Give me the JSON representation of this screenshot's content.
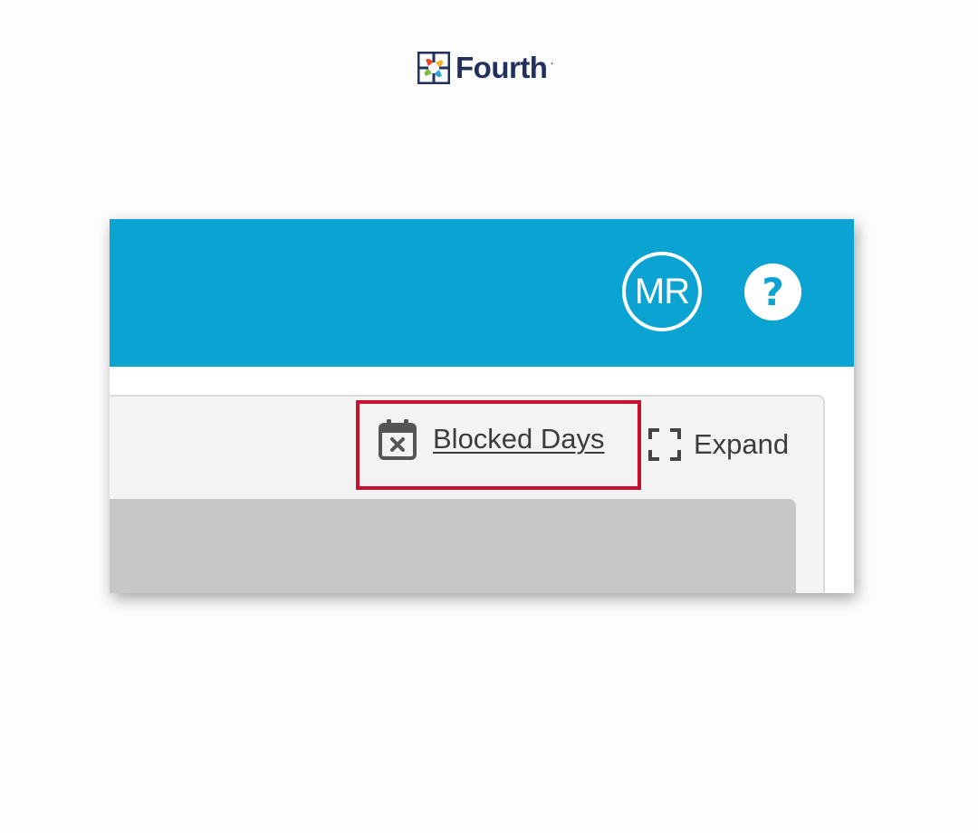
{
  "brand": {
    "name": "Fourth",
    "trademark_dot": ".",
    "color": "#22305e"
  },
  "header": {
    "background_color": "#0ba3d2",
    "avatar_initials": "MR",
    "help_symbol": "?"
  },
  "toolbar": {
    "blocked_days_label": "Blocked Days",
    "blocked_days_icon": "calendar-x-icon",
    "expand_label": "Expand",
    "expand_icon": "expand-corners-icon"
  },
  "highlight": {
    "color": "#c8102e",
    "target": "blocked-days-link"
  }
}
